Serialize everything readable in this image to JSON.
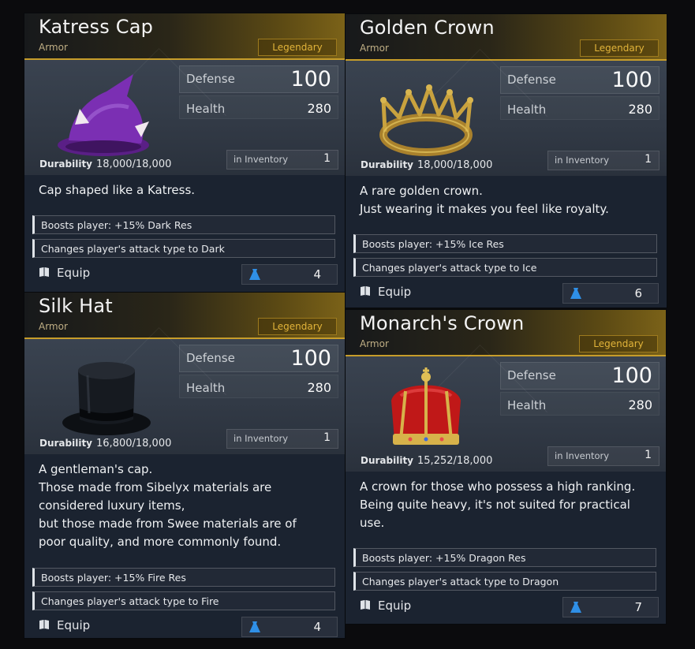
{
  "ui": {
    "defense_label": "Defense",
    "health_label": "Health",
    "durability_label": "Durability",
    "inventory_label": "in Inventory",
    "equip_label": "Equip"
  },
  "colors": {
    "rarity_gold": "#e2b43a",
    "header_border": "#c79d2a",
    "bag_icon": "#2f8fe6"
  },
  "icons": {
    "equip": "book-icon",
    "bag": "weight-bag-icon"
  },
  "cards": [
    {
      "name": "Katress Cap",
      "type": "Armor",
      "rarity": "Legendary",
      "defense": "100",
      "health": "280",
      "durability": "18,000/18,000",
      "in_inventory": "1",
      "description": [
        "Cap shaped like a Katress."
      ],
      "boosts": [
        "Boosts player: +15% Dark Res",
        "Changes player's attack type to Dark"
      ],
      "weight": "4"
    },
    {
      "name": "Golden Crown",
      "type": "Armor",
      "rarity": "Legendary",
      "defense": "100",
      "health": "280",
      "durability": "18,000/18,000",
      "in_inventory": "1",
      "description": [
        "A rare golden crown.",
        "Just wearing it makes you feel like royalty."
      ],
      "boosts": [
        "Boosts player: +15% Ice Res",
        "Changes player's attack type to Ice"
      ],
      "weight": "6"
    },
    {
      "name": "Silk Hat",
      "type": "Armor",
      "rarity": "Legendary",
      "defense": "100",
      "health": "280",
      "durability": "16,800/18,000",
      "in_inventory": "1",
      "description": [
        "A gentleman's cap.",
        "Those made from Sibelyx materials are",
        "considered luxury items,",
        "but those made from Swee materials are of",
        "poor quality, and more commonly found."
      ],
      "boosts": [
        "Boosts player: +15% Fire Res",
        "Changes player's attack type to Fire"
      ],
      "weight": "4"
    },
    {
      "name": "Monarch's Crown",
      "type": "Armor",
      "rarity": "Legendary",
      "defense": "100",
      "health": "280",
      "durability": "15,252/18,000",
      "in_inventory": "1",
      "description": [
        "A crown for those who possess a high ranking.",
        "Being quite heavy, it's not suited for practical",
        "use."
      ],
      "boosts": [
        "Boosts player: +15% Dragon Res",
        "Changes player's attack type to Dragon"
      ],
      "weight": "7"
    }
  ]
}
